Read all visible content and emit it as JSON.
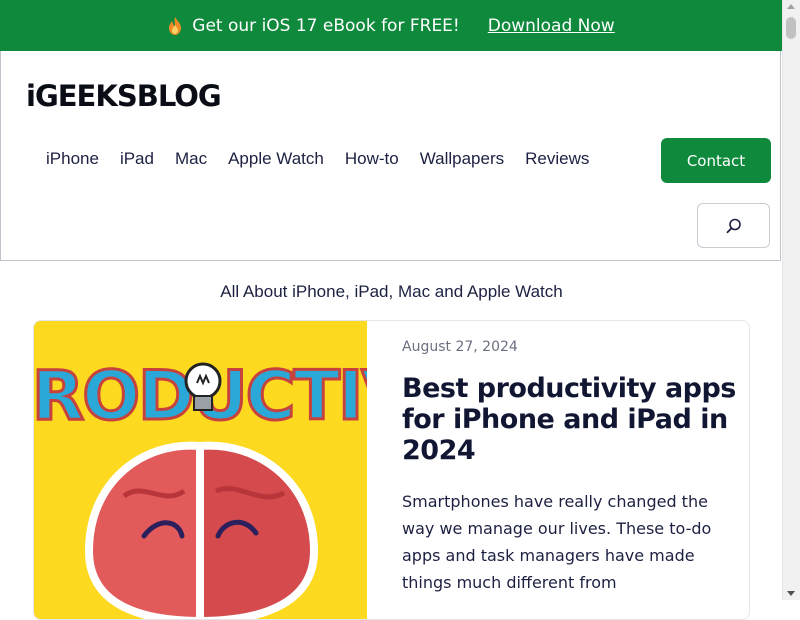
{
  "promo": {
    "text": "Get our iOS 17 eBook for FREE!",
    "link_label": "Download Now"
  },
  "header": {
    "logo_text": "iGEEKSBLOG",
    "nav": [
      "iPhone",
      "iPad",
      "Mac",
      "Apple Watch",
      "How-to",
      "Wallpapers",
      "Reviews"
    ],
    "contact_label": "Contact"
  },
  "tagline": "All About iPhone, iPad, Mac and Apple Watch",
  "article": {
    "image_text": "PRODUCTIVITY",
    "date": "August 27, 2024",
    "title": "Best productivity apps for iPhone and iPad in 2024",
    "excerpt": "Smartphones have really changed the way we manage our lives. These to-do apps and task managers have made things much different from"
  },
  "colors": {
    "brand_green": "#0f8a3d",
    "text_dark": "#1c2142",
    "image_yellow": "#fdd91f",
    "image_blue": "#2aa8d8",
    "brain_red": "#e35a5a"
  },
  "icons": [
    "flame-icon",
    "search-icon",
    "lightbulb-icon",
    "brain-illustration"
  ]
}
